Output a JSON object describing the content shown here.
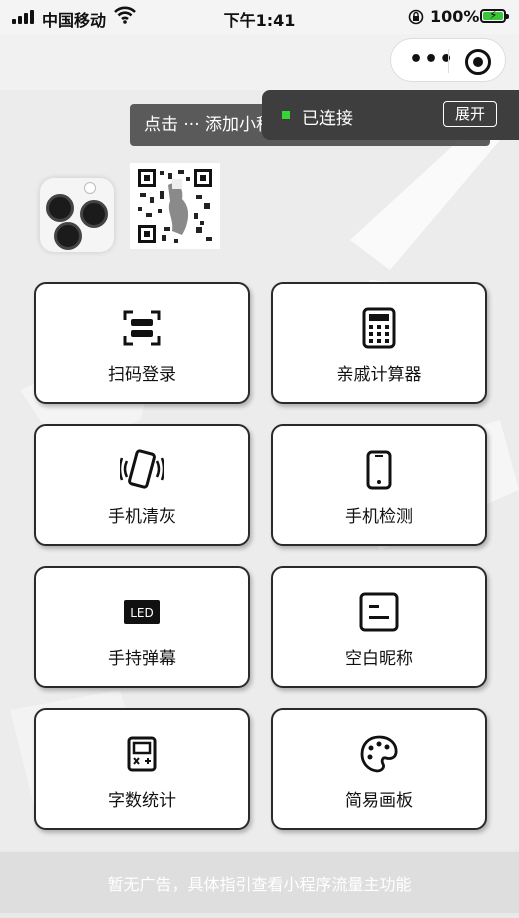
{
  "status_bar": {
    "carrier": "中国移动",
    "time": "下午1:41",
    "battery": "100%",
    "battery_level": 1.0
  },
  "toast": {
    "text": "点击 ··· 添加小程序，下次访问更方便"
  },
  "connection": {
    "status": "已连接",
    "expand_label": "展开",
    "indicator_color": "#37d337"
  },
  "menu": {
    "items": [
      {
        "label": "扫码登录",
        "icon": "scan-icon"
      },
      {
        "label": "亲戚计算器",
        "icon": "calculator-icon"
      },
      {
        "label": "手机清灰",
        "icon": "phone-vibrate-icon"
      },
      {
        "label": "手机检测",
        "icon": "phone-icon"
      },
      {
        "label": "手持弹幕",
        "icon": "led-icon",
        "badge": "LED"
      },
      {
        "label": "空白昵称",
        "icon": "blank-note-icon"
      },
      {
        "label": "字数统计",
        "icon": "counter-icon"
      },
      {
        "label": "简易画板",
        "icon": "palette-icon"
      }
    ]
  },
  "footer": {
    "text": "暂无广告，具体指引查看小程序流量主功能"
  }
}
